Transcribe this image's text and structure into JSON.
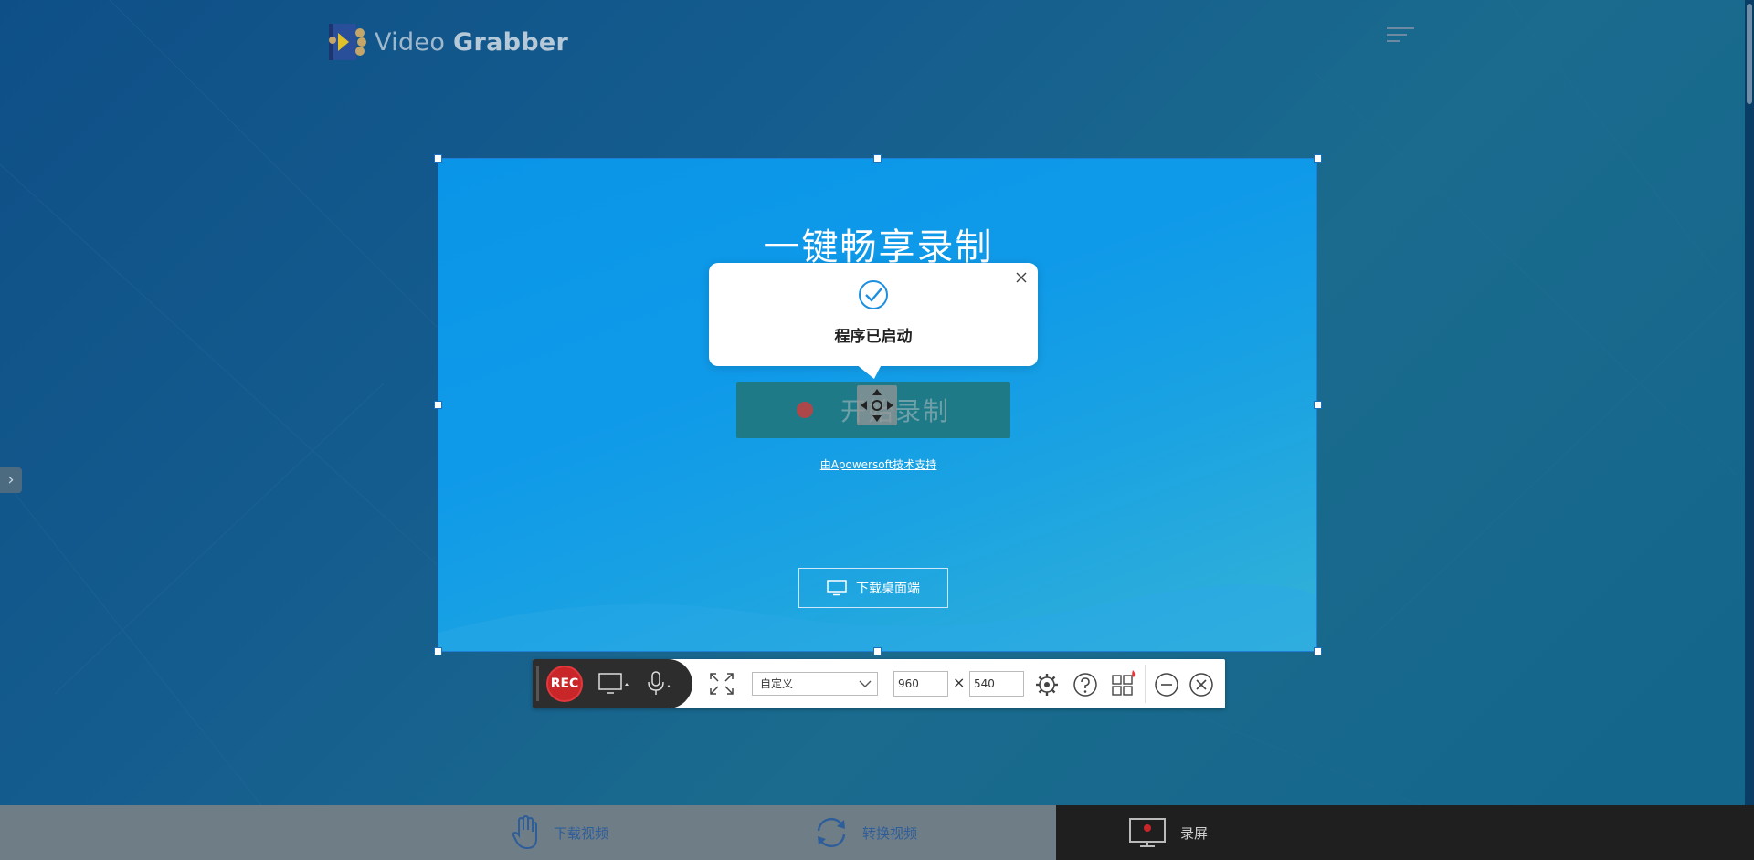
{
  "app": {
    "logo_light": "Video ",
    "logo_bold": "Grabber"
  },
  "header": {
    "menu_icon": "hamburger-menu-icon"
  },
  "side_tab": {
    "icon": "chevron-right-icon",
    "glyph": "›"
  },
  "capture": {
    "title": "一键畅享录制",
    "start_label": "开始录制",
    "support_link": "由Apowersoft技术支持",
    "download_desktop": "下载桌面端"
  },
  "popup": {
    "message": "程序已启动",
    "icon": "check-circle-icon"
  },
  "toolbar": {
    "rec_label": "REC",
    "preset_value": "自定义",
    "width_value": "960",
    "height_value": "540",
    "times_symbol": "×"
  },
  "bottom_nav": [
    {
      "label": "下载视频",
      "icon": "hand-icon"
    },
    {
      "label": "转换视频",
      "icon": "convert-icon"
    },
    {
      "label": "录屏",
      "icon": "screen-record-icon"
    }
  ],
  "colors": {
    "rec": "#c9262a",
    "capture_bg": "#0f9ae9",
    "nav_label": "#2e5e9a"
  }
}
